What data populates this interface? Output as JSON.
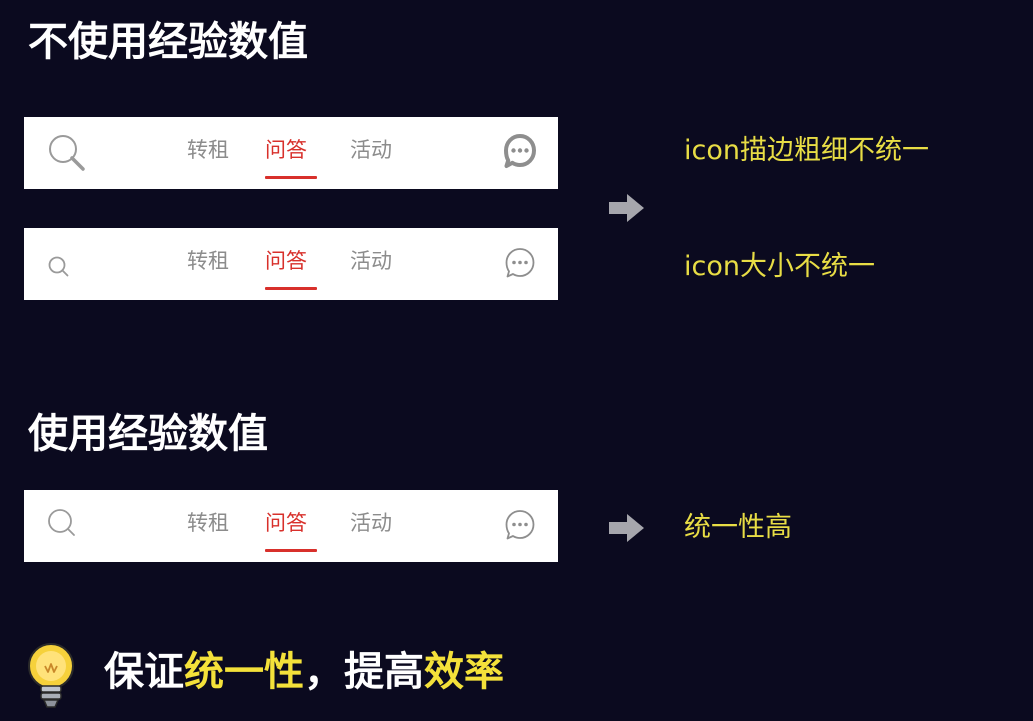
{
  "sections": {
    "bad_title": "不使用经验数值",
    "good_title": "使用经验数值"
  },
  "tabs": [
    "转租",
    "问答",
    "活动"
  ],
  "navbars": [
    {
      "left_icon": "search-icon",
      "right_icon": "chat-bubble-icon",
      "active_tab": 1
    },
    {
      "left_icon": "search-icon",
      "right_icon": "chat-bubble-icon",
      "active_tab": 1
    },
    {
      "left_icon": "search-icon",
      "right_icon": "chat-bubble-icon",
      "active_tab": 1
    }
  ],
  "notes": {
    "stroke_inconsistent": "icon描边粗细不统一",
    "size_inconsistent": "icon大小不统一",
    "consistent": "统一性高"
  },
  "tip": {
    "part1": "保证",
    "part2": "统一性",
    "part3": "，提高",
    "part4": "效率"
  },
  "colors": {
    "background": "#0b0a1f",
    "active_tab": "#d8302b",
    "inactive_tab": "#8c8c8c",
    "note_text": "#e8dd45",
    "highlight": "#f4e13a"
  }
}
